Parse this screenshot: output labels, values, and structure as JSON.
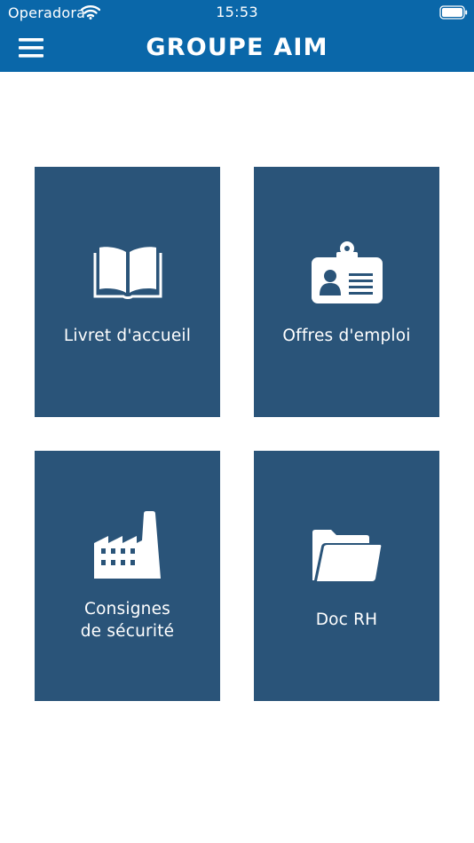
{
  "status_bar": {
    "carrier": "Operadora",
    "time": "15:53",
    "icons": [
      "wifi-icon",
      "battery-icon"
    ]
  },
  "header": {
    "title": "GROUPE AIM",
    "menu_icon": "hamburger-menu-icon"
  },
  "tiles": [
    {
      "label": "Livret d'accueil",
      "icon": "open-book-icon"
    },
    {
      "label": "Offres d'emploi",
      "icon": "id-badge-icon"
    },
    {
      "label_line1": "Consignes",
      "label_line2": "de sécurité",
      "icon": "factory-icon"
    },
    {
      "label": "Doc RH",
      "icon": "folder-icon"
    }
  ],
  "colors": {
    "header_bg": "#0a67a9",
    "tile_bg": "#2a5479",
    "text_on_dark": "#ffffff",
    "page_bg": "#ffffff"
  }
}
